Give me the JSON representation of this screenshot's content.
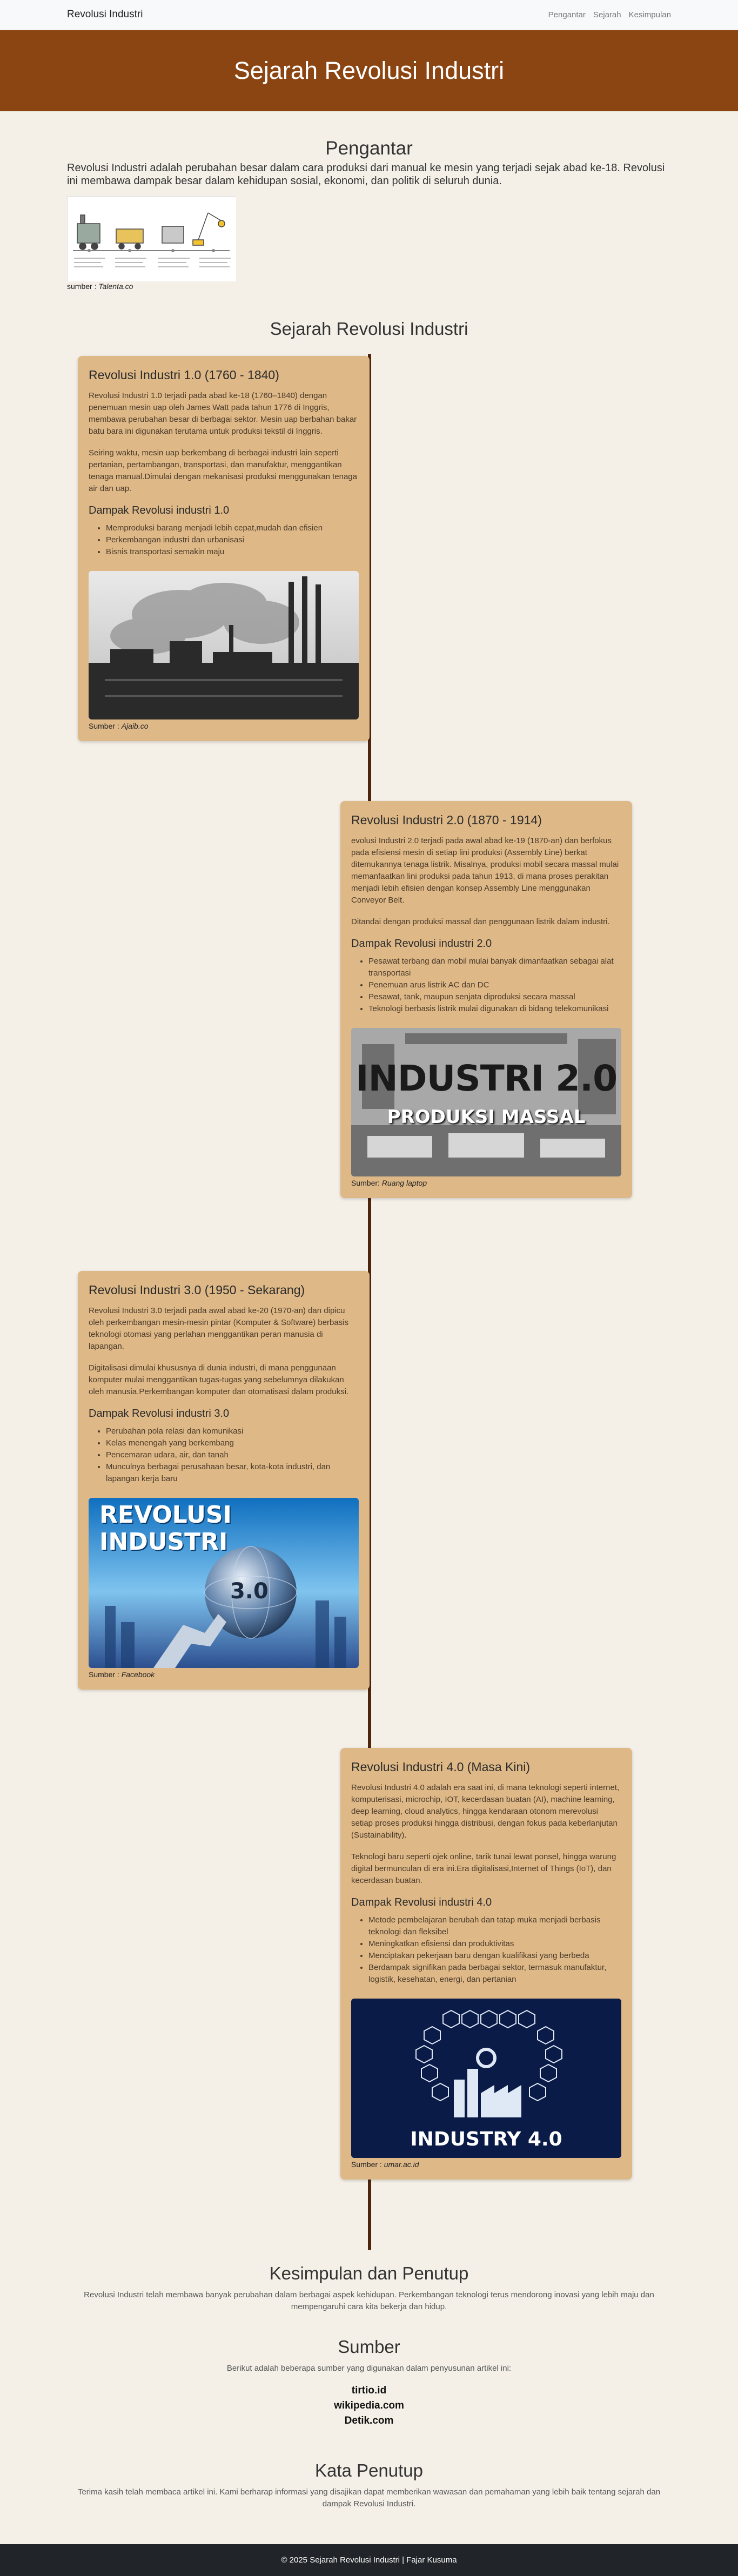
{
  "nav": {
    "brand": "Revolusi Industri",
    "links": [
      "Pengantar",
      "Sejarah",
      "Kesimpulan"
    ]
  },
  "hero": {
    "title": "Sejarah Revolusi Industri"
  },
  "intro": {
    "title": "Pengantar",
    "text": "Revolusi Industri adalah perubahan besar dalam cara produksi dari manual ke mesin yang terjadi sejak abad ke-18. Revolusi ini membawa dampak besar dalam kehidupan sosial, ekonomi, dan politik di seluruh dunia.",
    "caption_prefix": "sumber : ",
    "caption_source": "Talenta.co"
  },
  "history": {
    "title": "Sejarah Revolusi Industri",
    "items": [
      {
        "title": "Revolusi Industri 1.0 (1760 - 1840)",
        "p1": "Revolusi Industri 1.0 terjadi pada abad ke-18 (1760–1840) dengan penemuan mesin uap oleh James Watt pada tahun 1776 di Inggris, membawa perubahan besar di berbagai sektor. Mesin uap berbahan bakar batu bara ini digunakan terutama untuk produksi tekstil di Inggris.",
        "p2": "Seiring waktu, mesin uap berkembang di berbagai industri lain seperti pertanian, pertambangan, transportasi, dan manufaktur, menggantikan tenaga manual.Dimulai dengan mekanisasi produksi menggunakan tenaga air dan uap.",
        "impact_title": "Dampak Revolusi industri 1.0",
        "impacts": [
          "Memproduksi barang menjadi lebih cepat,mudah dan efisien",
          "Perkembangan industri dan urbanisasi",
          "Bisnis transportasi semakin maju"
        ],
        "caption_prefix": "Sumber : ",
        "caption_source": "Ajaib.co"
      },
      {
        "title": "Revolusi Industri 2.0 (1870 - 1914)",
        "p1": "evolusi Industri 2.0 terjadi pada awal abad ke-19 (1870-an) dan berfokus pada efisiensi mesin di setiap lini produksi (Assembly Line) berkat ditemukannya tenaga listrik. Misalnya, produksi mobil secara massal mulai memanfaatkan lini produksi pada tahun 1913, di mana proses perakitan menjadi lebih efisien dengan konsep Assembly Line menggunakan Conveyor Belt.",
        "p2": "Ditandai dengan produksi massal dan penggunaan listrik dalam industri.",
        "impact_title": "Dampak Revolusi industri 2.0",
        "impacts": [
          "Pesawat terbang dan mobil mulai banyak dimanfaatkan sebagai alat transportasi",
          "Penemuan arus listrik AC dan DC",
          "Pesawat, tank, maupun senjata diproduksi secara massal",
          "Teknologi berbasis listrik mulai digunakan di bidang telekomunikasi"
        ],
        "img_text1": "INDUSTRI 2.0",
        "img_text2": "PRODUKSI MASSAL",
        "caption_prefix": "Sumber: ",
        "caption_source": "Ruang laptop"
      },
      {
        "title": "Revolusi Industri 3.0 (1950 - Sekarang)",
        "p1": "Revolusi Industri 3.0 terjadi pada awal abad ke-20 (1970-an) dan dipicu oleh perkembangan mesin-mesin pintar (Komputer & Software) berbasis teknologi otomasi yang perlahan menggantikan peran manusia di lapangan.",
        "p2": "Digitalisasi dimulai khususnya di dunia industri, di mana penggunaan komputer mulai menggantikan tugas-tugas yang sebelumnya dilakukan oleh manusia.Perkembangan komputer dan otomatisasi dalam produksi.",
        "impact_title": "Dampak Revolusi industri 3.0",
        "impacts": [
          "Perubahan pola relasi dan komunikasi",
          "Kelas menengah yang berkembang",
          "Pencemaran udara, air, dan tanah",
          "Munculnya berbagai perusahaan besar, kota-kota industri, dan lapangan kerja baru"
        ],
        "img_text1": "REVOLUSI",
        "img_text2": "INDUSTRI",
        "img_text3": "3.0",
        "caption_prefix": "Sumber : ",
        "caption_source": "Facebook"
      },
      {
        "title": "Revolusi Industri 4.0 (Masa Kini)",
        "p1": "Revolusi Industri 4.0 adalah era saat ini, di mana teknologi seperti internet, komputerisasi, microchip, IOT, kecerdasan buatan (AI), machine learning, deep learning, cloud analytics, hingga kendaraan otonom merevolusi setiap proses produksi hingga distribusi, dengan fokus pada keberlanjutan (Sustainability).",
        "p2": "Teknologi baru seperti ojek online, tarik tunai lewat ponsel, hingga warung digital bermunculan di era ini.Era digitalisasi,Internet of Things (IoT), dan kecerdasan buatan.",
        "impact_title": "Dampak Revolusi industri 4.0",
        "impacts": [
          "Metode pembelajaran berubah dan tatap muka menjadi berbasis teknologi dan fleksibel",
          "Meningkatkan efisiensi dan produktivitas",
          "Menciptakan pekerjaan baru dengan kualifikasi yang berbeda",
          "Berdampak signifikan pada berbagai sektor, termasuk manufaktur, logistik, kesehatan, energi, dan pertanian"
        ],
        "img_text1": "INDUSTRY 4.0",
        "caption_prefix": "Sumber : ",
        "caption_source": "umar.ac.id"
      }
    ]
  },
  "conclusion": {
    "title": "Kesimpulan dan Penutup",
    "text": "Revolusi Industri telah membawa banyak perubahan dalam berbagai aspek kehidupan. Perkembangan teknologi terus mendorong inovasi yang lebih maju dan mempengaruhi cara kita bekerja dan hidup."
  },
  "sources": {
    "title": "Sumber",
    "intro": "Berikut adalah beberapa sumber yang digunakan dalam penyusunan artikel ini:",
    "list": [
      "tirtio.id",
      "wikipedia.com",
      "Detik.com"
    ]
  },
  "closing": {
    "title": "Kata Penutup",
    "text": "Terima kasih telah membaca artikel ini. Kami berharap informasi yang disajikan dapat memberikan wawasan dan pemahaman yang lebih baik tentang sejarah dan dampak Revolusi Industri."
  },
  "footer": {
    "text": "© 2025 Sejarah Revolusi Industri | Fajar Kusuma"
  },
  "colors": {
    "hero": "#8b4513",
    "card": "#deb887",
    "timeline": "#4d260d",
    "page": "#f4f0e8",
    "footer": "#212529"
  }
}
